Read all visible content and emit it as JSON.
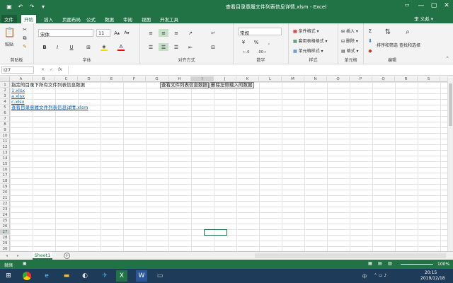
{
  "titlebar": {
    "title": "查看目录意履文件列表信息详情.xlsm - Excel",
    "icon": "excel-icon",
    "min": "—",
    "restore": "▢",
    "close": "✕"
  },
  "tabs": [
    {
      "label": "文件"
    },
    {
      "label": "开始"
    },
    {
      "label": "插入"
    },
    {
      "label": "页面布局"
    },
    {
      "label": "公式"
    },
    {
      "label": "数据"
    },
    {
      "label": "审阅"
    },
    {
      "label": "视图"
    },
    {
      "label": "开发工具"
    }
  ],
  "user": "李 义彪 ▾",
  "ribbon": {
    "clipboard": {
      "label": "剪贴板",
      "paste": "粘贴"
    },
    "font": {
      "label": "字体",
      "name": "宋体",
      "size": "11",
      "bold": "B",
      "italic": "I",
      "underline": "U"
    },
    "align": {
      "label": "对齐方式"
    },
    "number": {
      "label": "数字",
      "format": "常规"
    },
    "styles": {
      "label": "样式",
      "cond": "条件格式 ▾",
      "table": "套用表格格式 ▾",
      "cell": "单元格样式 ▾"
    },
    "cells": {
      "label": "单元格",
      "insert": "插入 ▾",
      "delete": "删除 ▾",
      "format": "格式 ▾"
    },
    "editing": {
      "label": "编辑",
      "sort": "排序和筛选",
      "find": "查找和选择"
    }
  },
  "formulabar": {
    "namebox": "I27",
    "fx": "fx"
  },
  "columns": [
    "A",
    "B",
    "C",
    "D",
    "E",
    "F",
    "G",
    "H",
    "I",
    "J",
    "K",
    "L",
    "M",
    "N",
    "O",
    "P",
    "Q",
    "R",
    "S"
  ],
  "rows": [
    "1",
    "2",
    "3",
    "4",
    "5",
    "6",
    "7",
    "8",
    "9",
    "10",
    "11",
    "12",
    "13",
    "14",
    "15",
    "16",
    "17",
    "18",
    "19",
    "20",
    "21",
    "22",
    "23",
    "24",
    "25",
    "26",
    "27",
    "28",
    "29",
    "30"
  ],
  "cells": {
    "a1": "指定的目录下所有文件列表信息数据",
    "a2": "1.xlsx",
    "a3": "a.xlsx",
    "a4": "c.xlsx",
    "a5": "查看目录意履文件列表信息详情.xlsm",
    "btn1": "查看文件列表信息数据",
    "btn2": "删除左侧载入的数据"
  },
  "sheet": {
    "name": "Sheet1",
    "add": "+"
  },
  "status": {
    "ready": "就绪",
    "zoom": "100%"
  },
  "taskbar": {
    "time": "20:15",
    "date": "2019/12/18",
    "lang": "中"
  }
}
